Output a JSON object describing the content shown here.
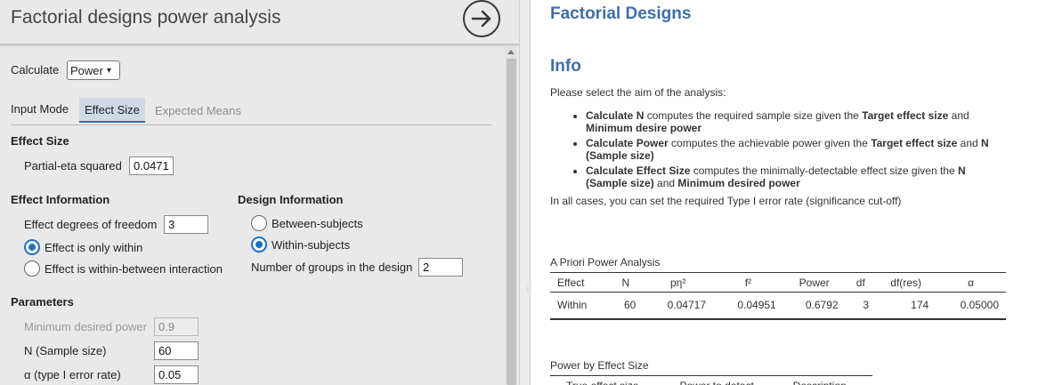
{
  "options": {
    "title": "Factorial designs power analysis",
    "calculate": {
      "label": "Calculate",
      "value": "Power"
    },
    "input_mode": {
      "label": "Input Mode",
      "tabs": [
        {
          "label": "Effect Size",
          "active": true
        },
        {
          "label": "Expected Means",
          "active": false
        }
      ]
    },
    "effect_size": {
      "heading": "Effect Size",
      "partial_eta_label": "Partial-eta squared",
      "partial_eta_value": "0.0471"
    },
    "effect_info": {
      "heading": "Effect Information",
      "df_label": "Effect degrees of freedom",
      "df_value": "3",
      "radio_within": "Effect is only within",
      "radio_interaction": "Effect is within-between interaction"
    },
    "design_info": {
      "heading": "Design Information",
      "radio_between": "Between-subjects",
      "radio_within": "Within-subjects",
      "groups_label": "Number of groups in the design",
      "groups_value": "2"
    },
    "parameters": {
      "heading": "Parameters",
      "min_power_label": "Minimum desired power",
      "min_power_value": "0.9",
      "n_label": "N (Sample size)",
      "n_value": "60",
      "alpha_label": "α (type I error rate)",
      "alpha_value": "0.05"
    }
  },
  "results": {
    "title": "Factorial Designs",
    "info_heading": "Info",
    "info_intro": "Please select the aim of the analysis:",
    "bullets": [
      {
        "b1": "Calculate N",
        "t1": " computes the required sample size given the ",
        "b2": "Target effect size",
        "t2": " and ",
        "b3": "Minimum desire power",
        "t3": ""
      },
      {
        "b1": "Calculate Power",
        "t1": " computes the achievable power given the ",
        "b2": "Target effect size",
        "t2": " and ",
        "b3": "N (Sample size)",
        "t3": ""
      },
      {
        "b1": "Calculate Effect Size",
        "t1": " computes the minimally-detectable effect size given the ",
        "b2": "N (Sample size)",
        "t2": " and ",
        "b3": "Minimum desired power",
        "t3": ""
      }
    ],
    "info_footer": "In all cases, you can set the required Type I error rate (significance cut-off)",
    "apriori": {
      "title": "A Priori Power Analysis",
      "columns": [
        "Effect",
        "N",
        "pη²",
        "f²",
        "Power",
        "df",
        "df(res)",
        "α"
      ],
      "rows": [
        [
          "Within",
          "60",
          "0.04717",
          "0.04951",
          "0.6792",
          "3",
          "174",
          "0.05000"
        ]
      ]
    },
    "by_effect": {
      "title": "Power by Effect Size",
      "columns": [
        "True effect size",
        "Power to detect",
        "Description"
      ]
    }
  },
  "colors": {
    "accent": "#3e6fa5",
    "radio": "#1a73c8"
  },
  "icons": {
    "back": "circle-arrow-right-icon"
  }
}
